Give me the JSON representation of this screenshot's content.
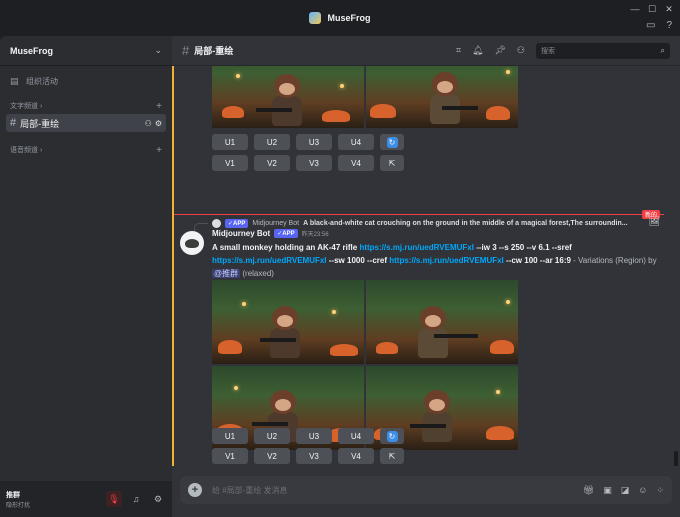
{
  "window": {
    "title": "MuseFrog",
    "icons": [
      "minimize-icon",
      "maximize-icon",
      "close-icon",
      "inbox-icon",
      "help-icon"
    ]
  },
  "sidebar": {
    "server_name": "MuseFrog",
    "events_label": "组织活动",
    "text_category": "文字频道",
    "active_channel": "局部-重绘",
    "voice_category": "语音频道"
  },
  "user_panel": {
    "name": "推群",
    "status": "隐形打扰"
  },
  "channel_header": {
    "title": "局部-重绘",
    "search_placeholder": "搜索"
  },
  "prev_message": {
    "buttons_row1": [
      "U1",
      "U2",
      "U3",
      "U4"
    ],
    "buttons_row2": [
      "V1",
      "V2",
      "V3",
      "V4"
    ]
  },
  "divider": {
    "badge": "新的"
  },
  "reply": {
    "app_badge": "✓APP",
    "author": "Midjourney Bot",
    "text": "A black-and-white cat crouching on the ground in the middle of a magical forest,The surroundin..."
  },
  "message": {
    "author": "Midjourney Bot",
    "app_badge": "✓APP",
    "timestamp": "昨天23:56",
    "prompt": "A small monkey holding an AK-47 rifle",
    "link1": "https://s.mj.run/uedRVEMUFxI",
    "params1": "--iw 3 --s 250 --v 6.1 --sref",
    "link2": "https://s.mj.run/uedRVEMUFxI",
    "params2": "--sw 1000 --cref",
    "link3": "https://s.mj.run/uedRVEMUFxI",
    "params3": "--cw 100 --ar 16:9",
    "suffix": "- Variations (Region) by",
    "mention": "@推群",
    "mode": "(relaxed)",
    "buttons_row1": [
      "U1",
      "U2",
      "U3",
      "U4"
    ],
    "buttons_row2": [
      "V1",
      "V2",
      "V3",
      "V4"
    ]
  },
  "composer": {
    "placeholder": "给 #局部-重绘 发消息"
  },
  "colors": {
    "accent": "#5865f2",
    "link": "#00a8fc",
    "new_divider": "#f23f43",
    "highlight_bar": "#f0b232"
  }
}
